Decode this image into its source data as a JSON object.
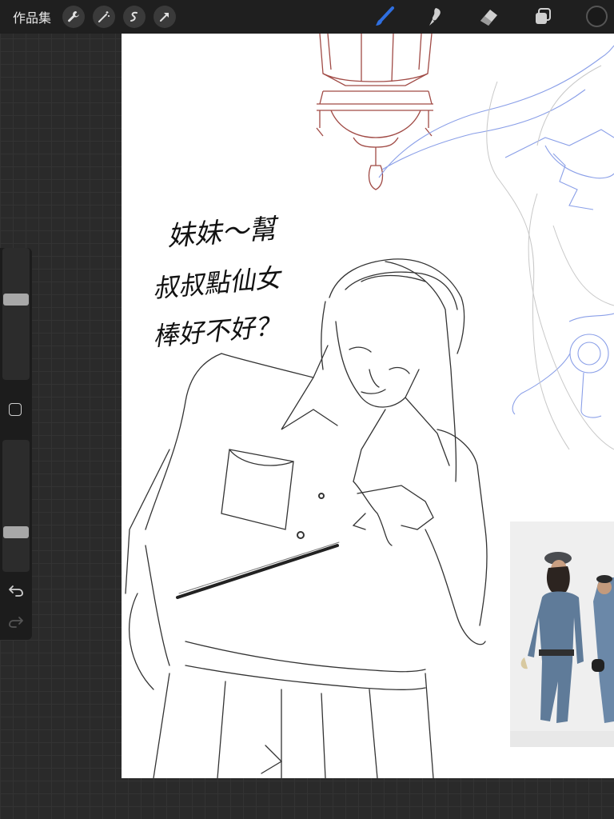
{
  "topbar": {
    "gallery_label": "作品集"
  },
  "tools": {
    "active_color": "#1a1a1a",
    "accent_color": "#2f6fe0",
    "icons": [
      "wrench-icon",
      "magic-wand-icon",
      "selection-icon",
      "transform-arrow-icon",
      "brush-icon",
      "smudge-icon",
      "eraser-icon",
      "layers-icon"
    ]
  },
  "canvas": {
    "handwritten_note": [
      "妹妹～幫",
      "叔叔點仙女",
      "棒好不好？"
    ]
  },
  "sidebar": {
    "brush_size_fraction": 0.62,
    "opacity_fraction": 0.28
  }
}
